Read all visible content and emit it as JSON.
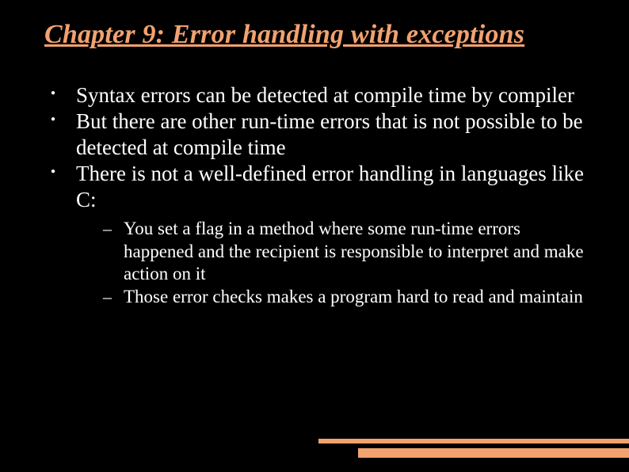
{
  "title": "Chapter 9: Error handling with exceptions",
  "bullets": [
    "Syntax errors can be detected at compile time by compiler",
    "But there are other run-time errors that is not possible to be detected at compile time",
    "There is not a well-defined error handling in languages like C:"
  ],
  "subbullets": [
    "You set a flag in a method where some run-time errors happened and the recipient is responsible to interpret and make action on it",
    "Those error checks makes a program hard to read and maintain"
  ]
}
